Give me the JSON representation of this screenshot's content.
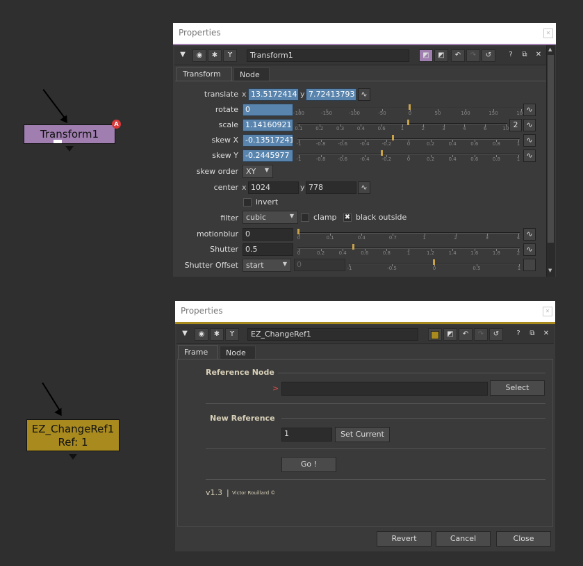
{
  "node_graph": {
    "transform_node": {
      "name": "Transform1",
      "badge": "A",
      "color": "#a07fb0"
    },
    "change_ref_node": {
      "name": "EZ_ChangeRef1",
      "ref_line": "Ref: 1",
      "color": "#a88a1e"
    }
  },
  "panel1": {
    "title": "Properties",
    "node_name": "Transform1",
    "tabs": [
      "Transform",
      "Node"
    ],
    "translate": {
      "label": "translate",
      "x_axis": "x",
      "x": "13.5172414",
      "y_axis": "y",
      "y": "7.72413793"
    },
    "rotate": {
      "label": "rotate",
      "value": "0",
      "ticks": [
        "-180",
        "-150",
        "-100",
        "-50",
        "0",
        "50",
        "100",
        "150",
        "180"
      ],
      "level": 0.5
    },
    "scale": {
      "label": "scale",
      "value": "1.14160921",
      "ticks": [
        "0.1",
        "0.2",
        "0.3",
        "0.4",
        "0.6",
        "1",
        "2",
        "3",
        "4",
        "6",
        "10"
      ],
      "badge": "2",
      "level": 0.53
    },
    "skewx": {
      "label": "skew X",
      "value": "-0.13517241",
      "ticks": [
        "-1",
        "-0.8",
        "-0.6",
        "-0.4",
        "-0.2",
        "0",
        "0.2",
        "0.4",
        "0.6",
        "0.8",
        "1"
      ],
      "level": 0.43
    },
    "skewy": {
      "label": "skew Y",
      "value": "-0.2445977",
      "ticks": [
        "-1",
        "-0.8",
        "-0.6",
        "-0.4",
        "-0.2",
        "0",
        "0.2",
        "0.4",
        "0.6",
        "0.8",
        "1"
      ],
      "level": 0.38
    },
    "skew_order": {
      "label": "skew order",
      "value": "XY"
    },
    "center": {
      "label": "center",
      "x_axis": "x",
      "x": "1024",
      "y_axis": "y",
      "y": "778"
    },
    "invert": {
      "label": "invert"
    },
    "filter": {
      "label": "filter",
      "value": "cubic",
      "clamp_label": "clamp",
      "black_outside_label": "black outside",
      "black_outside_checked": "✖"
    },
    "motionblur": {
      "label": "motionblur",
      "value": "0",
      "ticks": [
        "0",
        "0.1",
        "0.4",
        "0.7",
        "1",
        "2",
        "3",
        "4"
      ],
      "level": 0.0
    },
    "shutter": {
      "label": "Shutter",
      "value": "0.5",
      "ticks": [
        "0",
        "0.2",
        "0.4",
        "0.6",
        "0.8",
        "1",
        "1.2",
        "1.4",
        "1.6",
        "1.8",
        "2"
      ],
      "level": 0.25
    },
    "shutter_offset": {
      "label": "Shutter Offset",
      "value": "start",
      "offset_value": "0",
      "ticks": [
        "-1",
        "-0.5",
        "0",
        "0.5",
        "1"
      ],
      "level": 0.5
    }
  },
  "panel2": {
    "title": "Properties",
    "node_name": "EZ_ChangeRef1",
    "tabs": [
      "Frame",
      "Node"
    ],
    "reference_node": {
      "heading": "Reference Node",
      "marker": ">",
      "select_label": "Select"
    },
    "new_reference": {
      "heading": "New Reference",
      "value": "1",
      "set_current_label": "Set Current"
    },
    "go_label": "Go !",
    "version": "v1.3",
    "separator": "|",
    "author": "Victor Rouillard ©",
    "revert_label": "Revert",
    "cancel_label": "Cancel",
    "close_label": "Close"
  },
  "colors": {
    "accent_blue": "#5884ad",
    "slider_knob": "#c9a34a",
    "transform_node": "#a07fb0",
    "changeref_node": "#a88a1e"
  }
}
